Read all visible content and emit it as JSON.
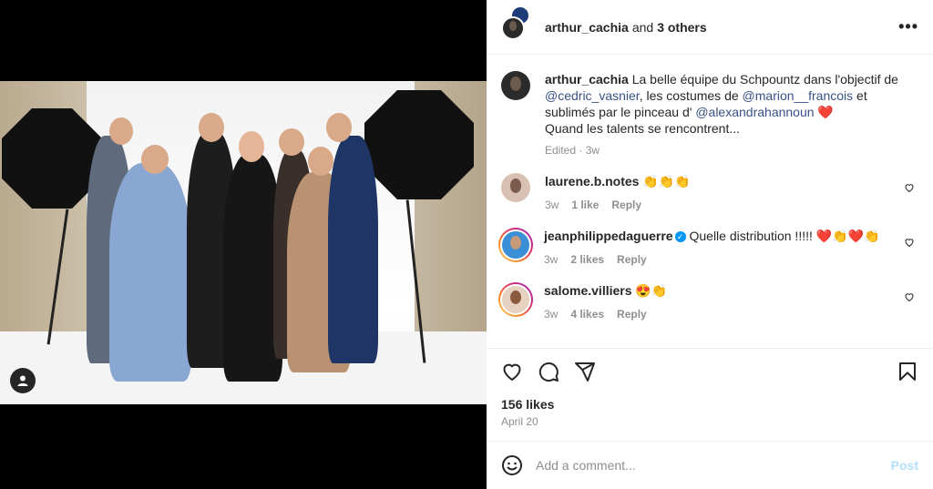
{
  "post": {
    "author": "arthur_cachia",
    "and_text": "and",
    "others": "3 others",
    "more_icon": "•••"
  },
  "caption": {
    "author": "arthur_cachia",
    "text1": " La belle équipe du Schpountz dans l'objectif de ",
    "mention1": "@cedric_vasnier",
    "text2": ", les costumes de ",
    "mention2": "@marion__francois",
    "text3": " et sublimés par le pinceau d' ",
    "mention3": "@alexandrahannoun",
    "text4": " ❤️",
    "line2": "Quand les talents se rencontrent...",
    "edited": "Edited",
    "sep": "·",
    "age": "3w"
  },
  "comments": [
    {
      "user": "laurene.b.notes",
      "text": "👏👏👏",
      "age": "3w",
      "likes": "1 like",
      "reply": "Reply"
    },
    {
      "user": "jeanphilippedaguerre",
      "verified": "✓",
      "text": " Quelle distribution !!!!! ❤️👏❤️👏",
      "age": "3w",
      "likes": "2 likes",
      "reply": "Reply"
    },
    {
      "user": "salome.villiers",
      "text": "😍👏",
      "age": "3w",
      "likes": "4 likes",
      "reply": "Reply"
    }
  ],
  "stats": {
    "likes": "156 likes",
    "date": "April 20"
  },
  "composer": {
    "placeholder": "Add a comment...",
    "post": "Post"
  },
  "colors": {
    "mention": "#385185",
    "post_disabled": "#b2dffc",
    "muted": "#8e8e8e"
  }
}
